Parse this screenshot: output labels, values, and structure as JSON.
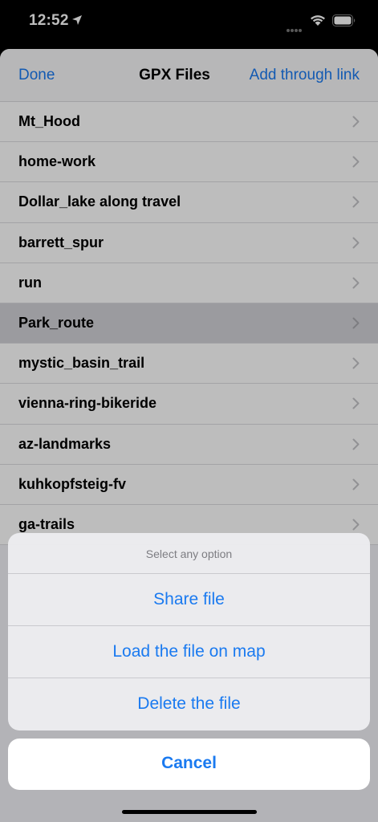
{
  "status_bar": {
    "time": "12:52",
    "icons": [
      "location-arrow-icon",
      "cellular-signal-icon",
      "wifi-icon",
      "battery-icon"
    ]
  },
  "nav": {
    "done_label": "Done",
    "title": "GPX Files",
    "add_label": "Add through link"
  },
  "files": [
    {
      "name": "Mt_Hood"
    },
    {
      "name": "home-work"
    },
    {
      "name": "Dollar_lake along travel"
    },
    {
      "name": "barrett_spur"
    },
    {
      "name": "run"
    },
    {
      "name": "Park_route",
      "selected": true
    },
    {
      "name": "mystic_basin_trail"
    },
    {
      "name": "vienna-ring-bikeride"
    },
    {
      "name": "az-landmarks"
    },
    {
      "name": "kuhkopfsteig-fv"
    },
    {
      "name": "ga-trails"
    }
  ],
  "action_sheet": {
    "header": "Select any option",
    "options": [
      "Share file",
      "Load the file on map",
      "Delete the file"
    ],
    "cancel_label": "Cancel"
  },
  "colors": {
    "accent": "#1a7af0",
    "selected_row": "#d2d2d7"
  }
}
